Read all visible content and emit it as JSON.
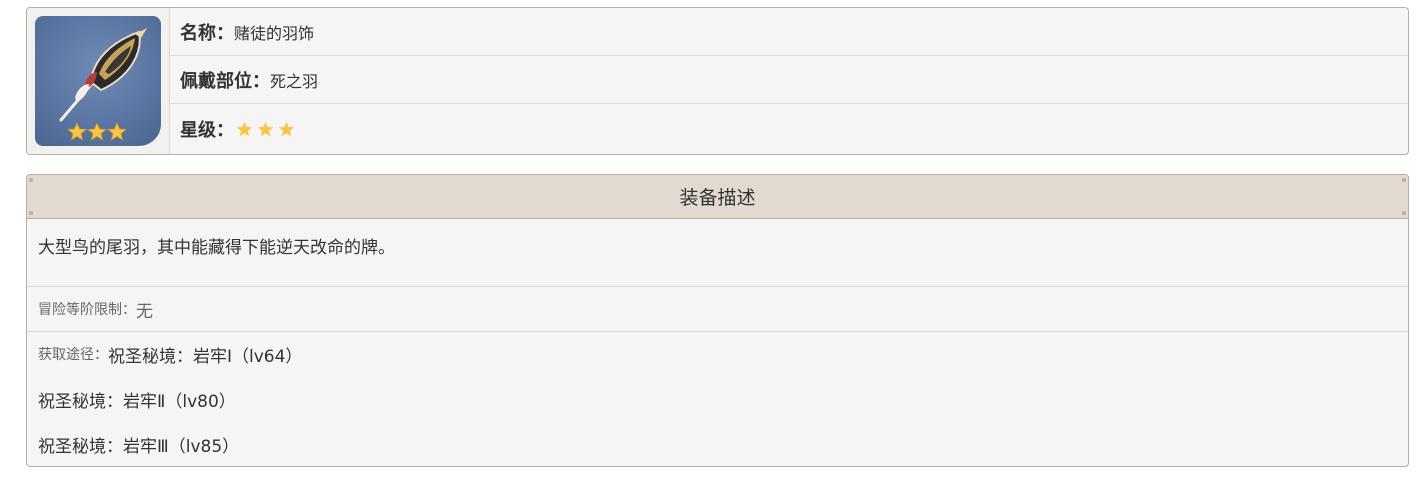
{
  "item": {
    "name_label": "名称：",
    "name_value": "赌徒的羽饰",
    "slot_label": "佩戴部位：",
    "slot_value": "死之羽",
    "rarity_label": "星级：",
    "rarity": 3,
    "icon": "feather-icon"
  },
  "description": {
    "header": "装备描述",
    "text": "大型鸟的尾羽，其中能藏得下能逆天改命的牌。",
    "limit_label": "冒险等阶限制：",
    "limit_value": "无",
    "source_label": "获取途径：",
    "sources": [
      "祝圣秘境：岩牢Ⅰ（lv64）",
      "祝圣秘境：岩牢Ⅱ（lv80）",
      "祝圣秘境：岩牢Ⅲ（lv85）"
    ]
  },
  "colors": {
    "star": "#f7c744",
    "header_bg": "#e2d9d0",
    "border": "#b8aea3"
  }
}
